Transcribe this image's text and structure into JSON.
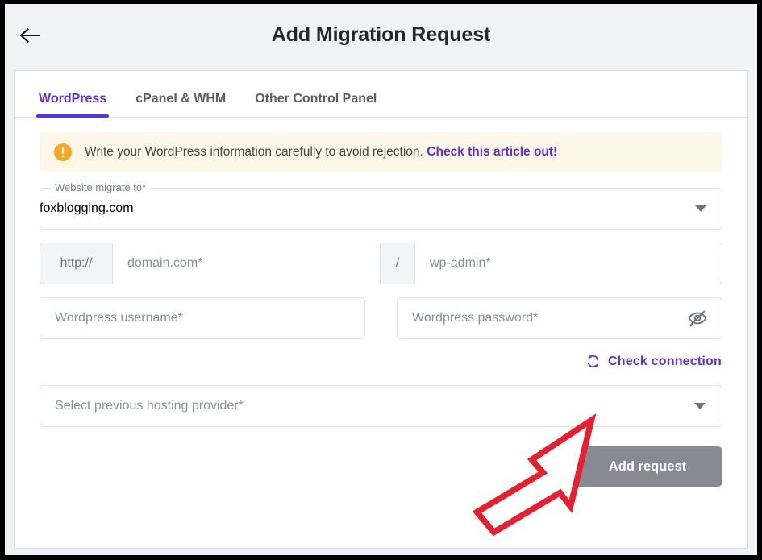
{
  "header": {
    "back_icon": "arrow-left-icon",
    "title": "Add Migration Request"
  },
  "tabs": [
    {
      "label": "WordPress",
      "active": true
    },
    {
      "label": "cPanel & WHM",
      "active": false
    },
    {
      "label": "Other Control Panel",
      "active": false
    }
  ],
  "alert": {
    "icon": "exclamation-circle-icon",
    "message": "Write your WordPress information carefully to avoid rejection.",
    "link_label": "Check this article out!",
    "background": "#fdf7e7",
    "icon_color": "#f5a623",
    "link_color": "#5c2fe8"
  },
  "website_select": {
    "label": "Website migrate to*",
    "value": "foxblogging.com",
    "caret_icon": "chevron-down-icon"
  },
  "url_row": {
    "protocol_label": "http://",
    "domain_placeholder": "domain.com*",
    "separator_label": "/",
    "path_placeholder": "wp-admin*"
  },
  "credentials": {
    "username_placeholder": "Wordpress username*",
    "password_placeholder": "Wordpress password*",
    "password_toggle_icon": "eye-slash-icon"
  },
  "check_connection": {
    "icon": "refresh-icon",
    "label": "Check connection",
    "color": "#5c2fe8"
  },
  "provider_select": {
    "placeholder": "Select previous hosting provider*",
    "caret_icon": "chevron-down-icon"
  },
  "submit": {
    "label": "Add request",
    "color": "#878a92",
    "disabled": true
  },
  "annotation": {
    "shape": "arrow-up-right",
    "color": "#e81f2e",
    "points_at": "Check connection"
  }
}
